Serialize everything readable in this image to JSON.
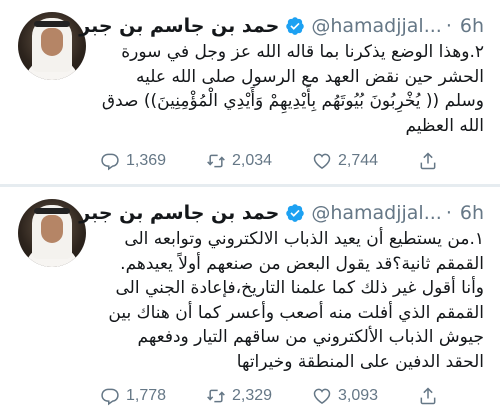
{
  "tweets": [
    {
      "display_name": "حمد بن جاسم بن جبر",
      "handle": "@hamadjjal...",
      "separator": "·",
      "time": "6h",
      "text": "٢.وهذا الوضع يذكرنا بما قاله الله عز وجل في سورة الحشر حين نقض العهد مع الرسول صلى الله عليه وسلم (( يُخْرِبُونَ بُيُوتَهُم بِأَيْدِيهِمْ وَأَيْدِي الْمُؤْمِنِينَ)) صدق الله العظيم",
      "replies": "1,369",
      "retweets": "2,034",
      "likes": "2,744"
    },
    {
      "display_name": "حمد بن جاسم بن جبر",
      "handle": "@hamadjjal...",
      "separator": "·",
      "time": "6h",
      "text": "١.من يستطيع أن يعيد الذباب الالكتروني وتوابعه الى القمقم ثانية؟قد يقول البعض من صنعهم أولاً يعيدهم. وأنا أقول غير ذلك كما علمنا التاريخ،فإعادة الجني الى القمقم الذي أفلت منه أصعب وأعسر كما أن هناك بين جيوش الذباب الألكتروني من ساقهم التيار ودفعهم الحقد الدفين على المنطقة وخيراتها",
      "replies": "1,778",
      "retweets": "2,329",
      "likes": "3,093"
    }
  ],
  "icons": {
    "verified": "verified-badge-icon",
    "reply": "reply-icon",
    "retweet": "retweet-icon",
    "like": "heart-icon",
    "share": "share-icon"
  },
  "colors": {
    "verified": "#1da1f2",
    "muted": "#657786",
    "text": "#14171a",
    "divider": "#e6ecf0"
  }
}
